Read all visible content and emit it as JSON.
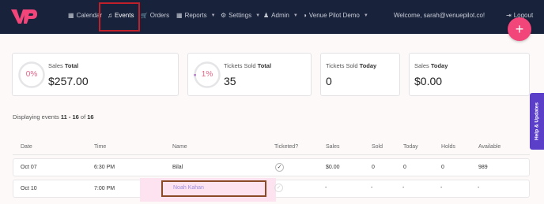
{
  "nav": {
    "items": [
      {
        "label": "Calendar",
        "icon": "calendar-icon",
        "glyph": "▦"
      },
      {
        "label": "Events",
        "icon": "music-note-icon",
        "glyph": "♫"
      },
      {
        "label": "Orders",
        "icon": "cart-icon",
        "glyph": "🛒"
      },
      {
        "label": "Reports",
        "icon": "grid-icon",
        "glyph": "▦"
      },
      {
        "label": "Settings",
        "icon": "gear-icon",
        "glyph": "⚙"
      },
      {
        "label": "Admin",
        "icon": "user-icon",
        "glyph": "♟"
      },
      {
        "label": "Venue Pilot Demo",
        "icon": "half-circle-icon",
        "glyph": "◑"
      }
    ],
    "welcome": "Welcome, sarah@venuepilot.co!",
    "logout": "Logout",
    "fab": "+"
  },
  "stats": [
    {
      "title": "Sales",
      "title_bold": "Total",
      "value": "$257.00",
      "ring": "0%",
      "progress": 0
    },
    {
      "title": "Tickets Sold",
      "title_bold": "Total",
      "value": "35",
      "ring": "1%",
      "progress": 0.01
    },
    {
      "title": "Tickets Sold",
      "title_bold": "Today",
      "value": "0"
    },
    {
      "title": "Sales",
      "title_bold": "Today",
      "value": "$0.00"
    }
  ],
  "displaying": {
    "prefix": "Displaying events",
    "range": "11 - 16",
    "of": "of",
    "total": "16"
  },
  "help_tab": "Help & Updates",
  "table": {
    "headers": [
      "Date",
      "Time",
      "Name",
      "Ticketed?",
      "Sales",
      "Sold",
      "Today",
      "Holds",
      "Available"
    ],
    "rows": [
      {
        "date": "Oct 07",
        "time": "6:30 PM",
        "name": "Bilal",
        "ticketed": "✓",
        "sales": "$0.00",
        "sold": "0",
        "today": "0",
        "holds": "0",
        "available": "989"
      },
      {
        "date": "Oct 10",
        "time": "7:00 PM",
        "name": "Noah Kahan",
        "ticketed": "✓",
        "sales": "-",
        "sold": "-",
        "today": "-",
        "holds": "-",
        "available": "-"
      }
    ]
  },
  "colors": {
    "nav_bg": "#18223b",
    "accent_pink": "#f2457a",
    "ring_text": "#e46286",
    "help_tab": "#5b3fc9",
    "highlight_red": "#c0202a"
  }
}
